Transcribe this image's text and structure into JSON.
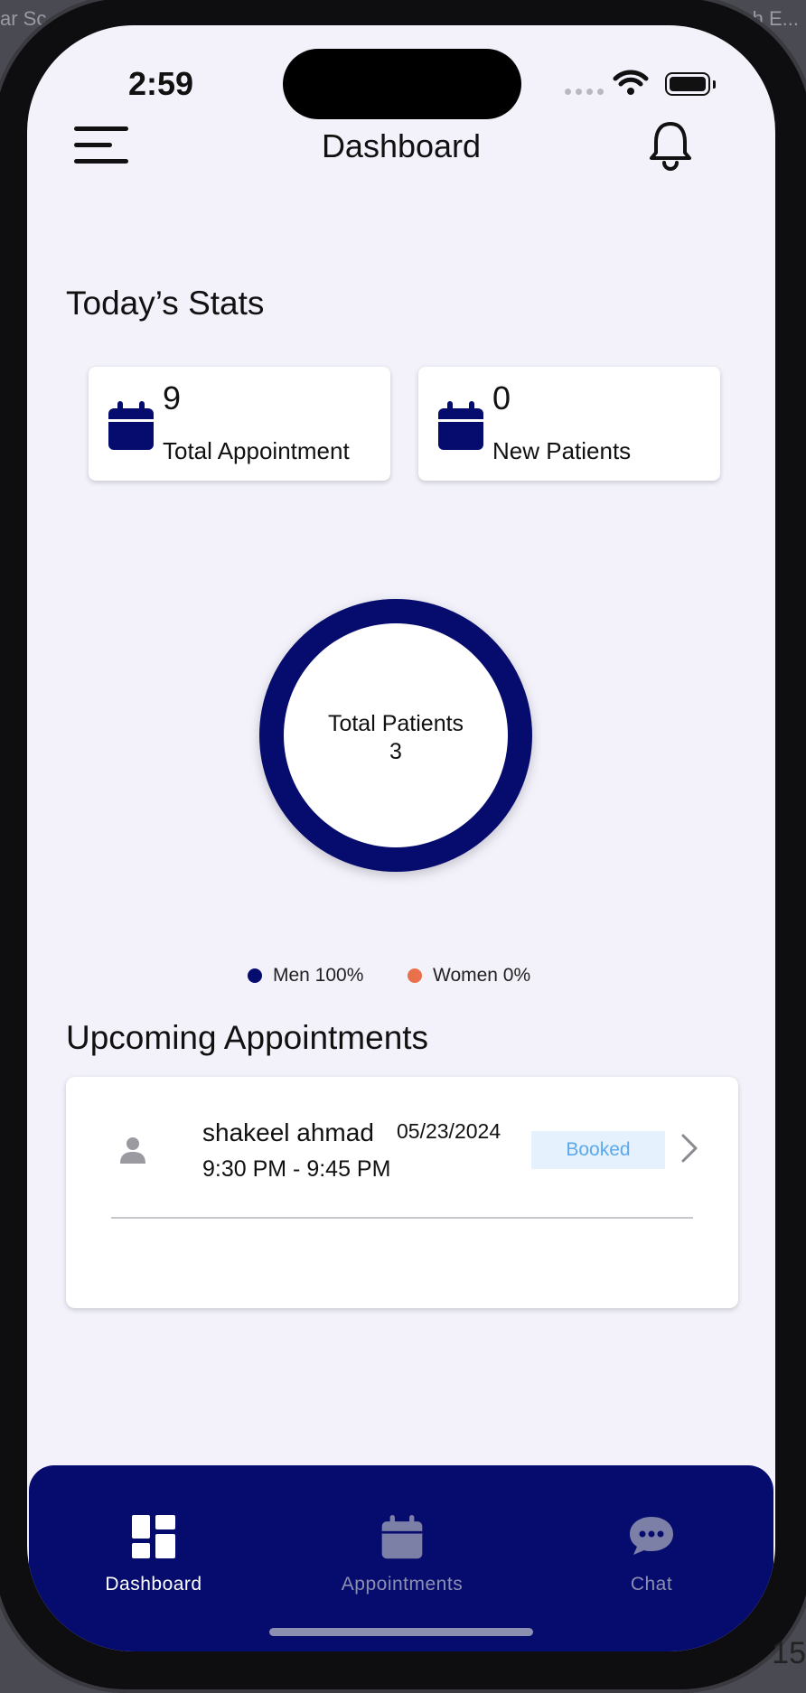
{
  "background": {
    "left_text": "ar Sc",
    "right_text": "h E...",
    "corner_text": "15"
  },
  "status_bar": {
    "time": "2:59"
  },
  "header": {
    "title": "Dashboard"
  },
  "stats": {
    "title": "Today’s Stats",
    "cards": [
      {
        "value": "9",
        "label": "Total Appointment"
      },
      {
        "value": "0",
        "label": "New Patients"
      }
    ]
  },
  "chart_data": {
    "type": "pie",
    "center_label": "Total Patients",
    "center_value": "3",
    "slices": [
      {
        "name": "Men",
        "value": 100,
        "color": "#060b6e"
      },
      {
        "name": "Women",
        "value": 0,
        "color": "#e8704a"
      }
    ]
  },
  "legend": {
    "men": "Men 100%",
    "women": "Women 0%"
  },
  "appointments": {
    "title": "Upcoming Appointments",
    "items": [
      {
        "name": "shakeel ahmad",
        "time": "9:30 PM - 9:45 PM",
        "date": "05/23/2024",
        "status": "Booked"
      }
    ]
  },
  "bottom_nav": {
    "items": [
      {
        "label": "Dashboard",
        "active": true
      },
      {
        "label": "Appointments",
        "active": false
      },
      {
        "label": "Chat",
        "active": false
      }
    ]
  },
  "colors": {
    "primary": "#060b6e",
    "status_booked_bg": "#e5f1fc",
    "status_booked_text": "#5aa9ef",
    "women": "#e8704a"
  }
}
